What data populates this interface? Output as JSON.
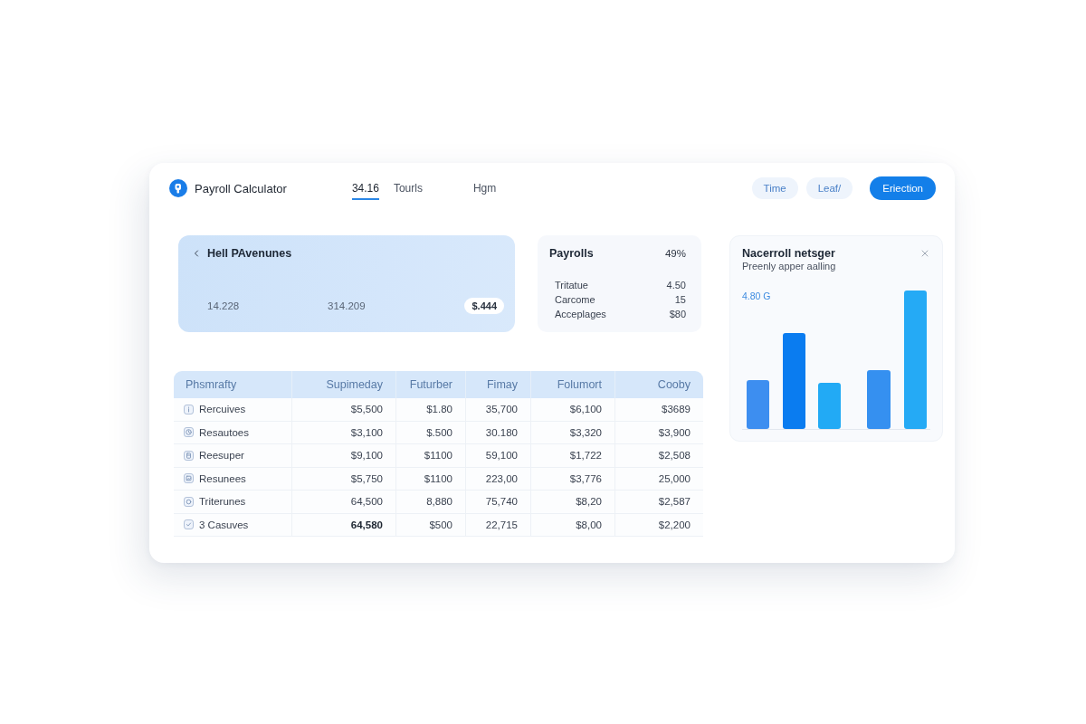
{
  "app": {
    "title": "Payroll Calculator"
  },
  "tabs": [
    {
      "label": "34.16",
      "selected": true
    },
    {
      "label": "Tourls",
      "selected": false
    },
    {
      "label": "Hgm",
      "selected": false
    }
  ],
  "actions": [
    {
      "label": "Time",
      "kind": "secondary"
    },
    {
      "label": "Leaf/",
      "kind": "secondary"
    },
    {
      "label": "Eriection",
      "kind": "primary"
    }
  ],
  "hero_card": {
    "title": "Hell PAvenunes",
    "values": [
      "14.228",
      "314.209"
    ],
    "badge": "$.444"
  },
  "payrolls_card": {
    "title": "Payrolls",
    "percent": "49%",
    "rows": [
      {
        "label": "Tritatue",
        "value": "4.50"
      },
      {
        "label": "Carcome",
        "value": "15"
      },
      {
        "label": "Acceplages",
        "value": "$80"
      }
    ]
  },
  "chart_panel": {
    "title": "Nacerroll netsger",
    "subtitle": "Preenly apper aalling",
    "reading": "4.80 G"
  },
  "table": {
    "columns": [
      "Phsmrafty",
      "Supimeday",
      "Futurber",
      "Fimay",
      "Folumort",
      "Cooby"
    ],
    "rows": [
      {
        "kind": "item",
        "cells": [
          "Rercuives",
          "$5,500",
          "$1.80",
          "35,700",
          "$6,100",
          "$3689"
        ]
      },
      {
        "kind": "item",
        "cells": [
          "Resautoes",
          "$3,100",
          "$.500",
          "30.180",
          "$3,320",
          "$3,900"
        ]
      },
      {
        "kind": "item",
        "cells": [
          "Reesuper",
          "$9,100",
          "$1100",
          "59,100",
          "$1,722",
          "$2,508"
        ]
      },
      {
        "kind": "item",
        "cells": [
          "Resunees",
          "$5,750",
          "$1100",
          "223,00",
          "$3,776",
          "25,000"
        ]
      },
      {
        "kind": "item",
        "cells": [
          "Triterunes",
          "64,500",
          "8,880",
          "75,740",
          "$8,20",
          "$2,587"
        ]
      },
      {
        "kind": "total",
        "cells": [
          "3 Casuves",
          "64,580",
          "$500",
          "22,715",
          "$8,00",
          "$2,200"
        ]
      }
    ]
  }
}
